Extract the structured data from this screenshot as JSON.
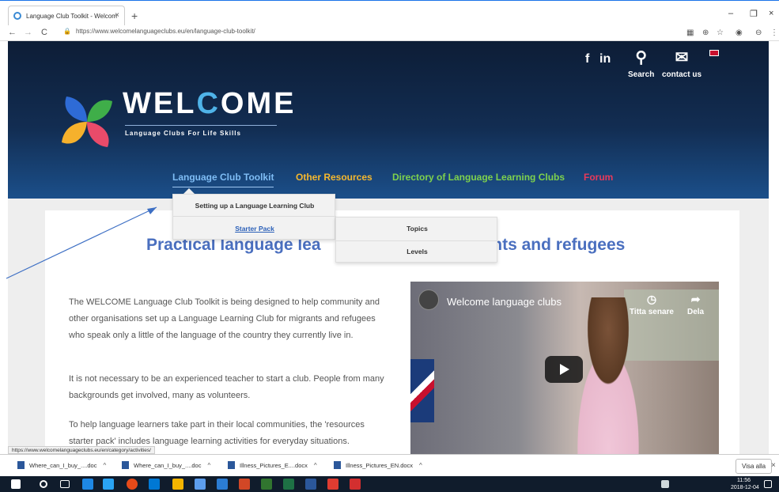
{
  "browser": {
    "tab_title": "Language Club Toolkit - Welcom",
    "tab_close": "×",
    "new_tab": "+",
    "url": "https://www.welcomelanguageclubs.eu/en/language-club-toolkit/",
    "status_url": "https://www.welcomelanguageclubs.eu/en/category/activities/",
    "win_min": "–",
    "win_max": "❐",
    "win_close": "×",
    "nav_back": "←",
    "nav_forward": "→",
    "nav_reload": "C"
  },
  "header": {
    "social_facebook": "f",
    "social_linkedin": "in",
    "search_label": "Search",
    "contact_label": "contact us",
    "logo_word_pre": "WEL",
    "logo_word_c": "C",
    "logo_word_post": "OME",
    "logo_tagline": "Language Clubs For Life Skills",
    "nav": [
      {
        "label": "Language Club Toolkit",
        "color": "#7fbdf5"
      },
      {
        "label": "Other Resources",
        "color": "#f5b82e"
      },
      {
        "label": "Directory of Language Learning Clubs",
        "color": "#7ed24d"
      },
      {
        "label": "Forum",
        "color": "#e8395a"
      }
    ]
  },
  "dropdown": {
    "items": [
      "Setting up a Language Learning Club",
      "Starter Pack"
    ],
    "submenu": [
      "Topics",
      "Levels"
    ]
  },
  "main": {
    "heading_left": "Practical language lea",
    "heading_right": "ants and refugees",
    "paragraphs": [
      "The WELCOME Language Club Toolkit is being designed to help community and other organisations set up a Language Learning Club for migrants and refugees who speak only a little of the language of the country they currently live in.",
      "It is not necessary to be an experienced teacher to start a club. People from many backgrounds get involved, many as volunteers.",
      "To help language learners take part in their local communities, the 'resources starter pack' includes language learning activities for everyday situations."
    ]
  },
  "video": {
    "title": "Welcome language clubs",
    "watch_later": "Titta senare",
    "share": "Dela"
  },
  "downloads": {
    "items": [
      "Where_can_I_buy_....doc",
      "Where_can_I_buy_....doc",
      "Illness_Pictures_E....docx",
      "Illness_Pictures_EN.docx"
    ],
    "show_all": "Visa alla",
    "close": "×"
  },
  "taskbar": {
    "time": "11:56",
    "date": "2018-12-04"
  }
}
